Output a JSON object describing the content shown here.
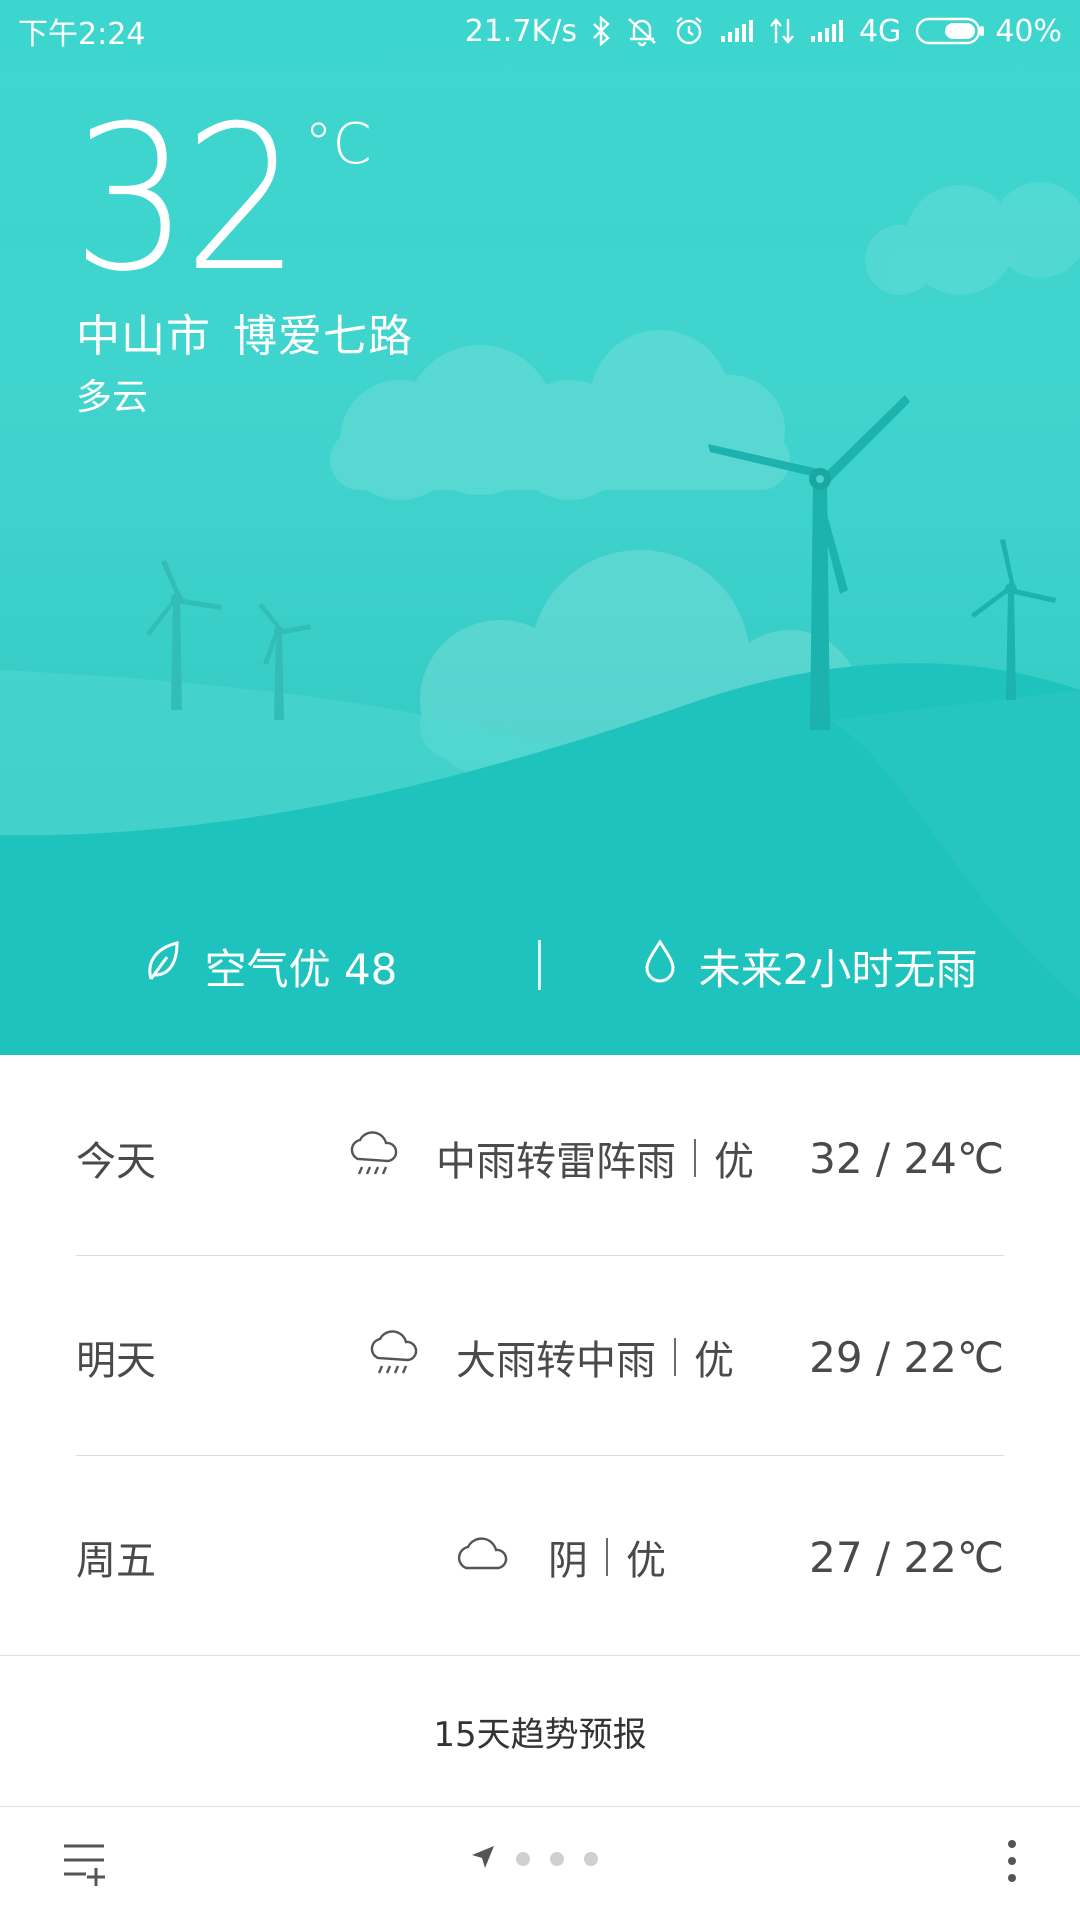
{
  "status_bar": {
    "time": "下午2:24",
    "net_speed": "21.7K/s",
    "network_type": "4G",
    "battery": "40%",
    "icons": [
      "bluetooth-icon",
      "mute-icon",
      "alarm-icon",
      "signal-icon",
      "data-arrows-icon",
      "signal-icon",
      "battery-icon"
    ]
  },
  "current": {
    "temperature": "32",
    "unit": "°C",
    "city": "中山市",
    "street": "博爱七路",
    "condition": "多云"
  },
  "summary": {
    "air_quality": "空气优 48",
    "rain_forecast": "未来2小时无雨",
    "air_icon": "leaf-icon",
    "rain_icon": "drop-icon"
  },
  "forecast": [
    {
      "day": "今天",
      "weather": "中雨转雷阵雨",
      "aqi": "优",
      "temps": "32 / 24℃",
      "icon": "rain-cloud-icon"
    },
    {
      "day": "明天",
      "weather": "大雨转中雨",
      "aqi": "优",
      "temps": "29 / 22℃",
      "icon": "rain-cloud-icon"
    },
    {
      "day": "周五",
      "weather": "阴",
      "aqi": "优",
      "temps": "27 / 22℃",
      "icon": "cloud-icon"
    }
  ],
  "trend_link": "15天趋势预报",
  "bottom_bar": {
    "left_icon": "add-city-menu-icon",
    "pager_icon": "location-arrow-icon",
    "right_icon": "more-vertical-icon"
  },
  "colors": {
    "sky_top": "#3dd6cf",
    "hill_back": "#56dad3",
    "hill_front": "#20c2bc",
    "text_dark": "#4a4a4a"
  }
}
